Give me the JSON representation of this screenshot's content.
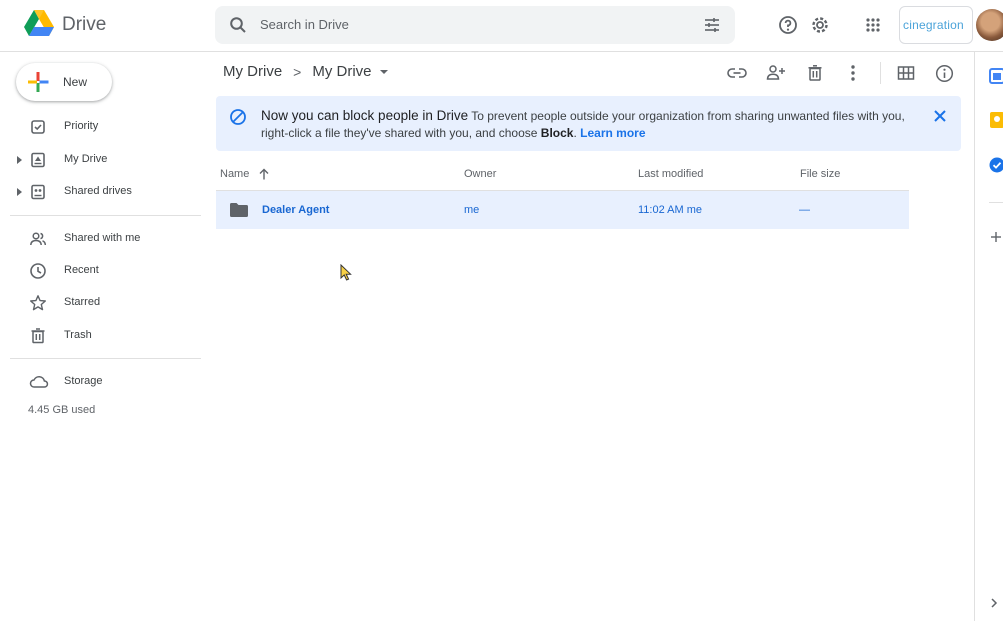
{
  "header": {
    "app_title": "Drive",
    "search_placeholder": "Search in Drive",
    "org_name": "cinegration"
  },
  "sidebar": {
    "new_label": "New",
    "items": [
      {
        "label": "Priority",
        "icon": "priority-icon",
        "expandable": false
      },
      {
        "label": "My Drive",
        "icon": "my-drive-icon",
        "expandable": true
      },
      {
        "label": "Shared drives",
        "icon": "shared-drives-icon",
        "expandable": true
      },
      {
        "label": "Shared with me",
        "icon": "people-icon",
        "expandable": false
      },
      {
        "label": "Recent",
        "icon": "clock-icon",
        "expandable": false
      },
      {
        "label": "Starred",
        "icon": "star-icon",
        "expandable": false
      },
      {
        "label": "Trash",
        "icon": "trash-icon",
        "expandable": false
      },
      {
        "label": "Storage",
        "icon": "cloud-icon",
        "expandable": false
      }
    ],
    "storage_used": "4.45 GB used"
  },
  "breadcrumb": {
    "root": "My Drive",
    "separator": ">",
    "current": "My Drive"
  },
  "banner": {
    "title": "Now you can block people in Drive",
    "body_1": " To prevent people outside your organization from sharing unwanted files with you, right-click a file they've shared with you, and choose ",
    "bold": "Block",
    "body_2": ". ",
    "link": "Learn more"
  },
  "table": {
    "columns": {
      "name": "Name",
      "owner": "Owner",
      "modified": "Last modified",
      "size": "File size"
    },
    "sort_column": "Name",
    "sort_direction": "ascending",
    "rows": [
      {
        "name": "Dealer Agent",
        "type": "folder",
        "owner": "me",
        "modified": "11:02 AM  me",
        "size": "—",
        "selected": true
      }
    ]
  },
  "colors": {
    "accent": "#1a73e8",
    "selected_row": "#e8f0fe",
    "banner_bg": "#e8f0fe",
    "text": "#3c4043",
    "muted": "#5f6368"
  }
}
